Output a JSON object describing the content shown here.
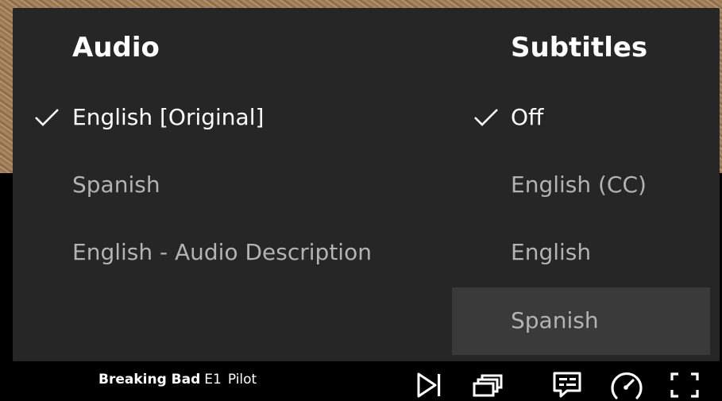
{
  "audio": {
    "title": "Audio",
    "options": [
      {
        "label": "English [Original]",
        "selected": true
      },
      {
        "label": "Spanish",
        "selected": false
      },
      {
        "label": "English - Audio Description",
        "selected": false
      }
    ]
  },
  "subtitles": {
    "title": "Subtitles",
    "options": [
      {
        "label": "Off",
        "selected": true
      },
      {
        "label": "English (CC)",
        "selected": false
      },
      {
        "label": "English",
        "selected": false
      },
      {
        "label": "Spanish",
        "selected": false,
        "hovered": true
      }
    ]
  },
  "player": {
    "show_title": "Breaking Bad",
    "episode_number": "E1",
    "episode_title": "Pilot",
    "icons": [
      "next-episode-icon",
      "episodes-icon",
      "audio-subtitles-icon",
      "playback-speed-icon",
      "fullscreen-icon"
    ]
  },
  "colors": {
    "panel_background": "#262626",
    "hover_background": "#3a3a3a",
    "selected_text": "#ffffff",
    "unselected_text": "#b3b3b3"
  }
}
